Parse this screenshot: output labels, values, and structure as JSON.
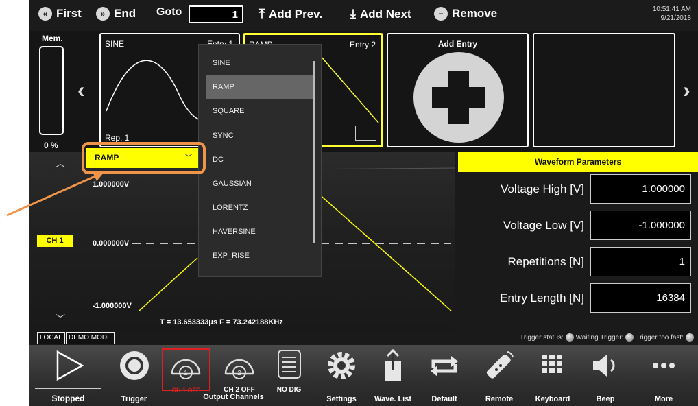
{
  "toolbar": {
    "first": "First",
    "end": "End",
    "goto": "Goto",
    "goto_value": "1",
    "add_prev": "Add Prev.",
    "add_next": "Add Next",
    "remove": "Remove",
    "time": "10:51:41 AM",
    "date": "9/21/2018"
  },
  "memory": {
    "label": "Mem.",
    "percent": "0 %"
  },
  "entries": [
    {
      "name": "SINE",
      "entry": "Entry 1",
      "rep": "Rep. 1"
    },
    {
      "name": "RAMP",
      "entry": "Entry 2"
    }
  ],
  "add_entry": "Add Entry",
  "waveform_select": {
    "selected": "RAMP",
    "options": [
      "SINE",
      "RAMP",
      "SQUARE",
      "SYNC",
      "DC",
      "GAUSSIAN",
      "LORENTZ",
      "HAVERSINE",
      "EXP_RISE"
    ]
  },
  "plot": {
    "vhigh": "1.000000V",
    "vzero": "0.000000V",
    "vlow": "-1.000000V",
    "channel": "CH 1",
    "tf": "T =  13.653333μs  F =  73.242188KHz"
  },
  "params": {
    "title": "Waveform Parameters",
    "rows": [
      {
        "label": "Voltage High [V]",
        "value": "1.000000"
      },
      {
        "label": "Voltage Low [V]",
        "value": "-1.000000"
      },
      {
        "label": "Repetitions [N]",
        "value": "1"
      },
      {
        "label": "Entry Length [N]",
        "value": "16384"
      }
    ]
  },
  "modes": {
    "local": "LOCAL",
    "demo": "DEMO MODE"
  },
  "trigger_status": {
    "status": "Trigger status:",
    "waiting": "Waiting Trigger:",
    "too_fast": "Trigger too fast:"
  },
  "bottom": {
    "stopped": "Stopped",
    "trigger": "Trigger",
    "ch1": "CH 1 OFF",
    "ch2": "CH 2 OFF",
    "nodig": "NO DIG",
    "output_channels": "Output Channels",
    "settings": "Settings",
    "wave_list": "Wave. List",
    "default": "Default",
    "remote": "Remote",
    "keyboard": "Keyboard",
    "beep": "Beep",
    "more": "More"
  },
  "colors": {
    "accent": "#ffff00",
    "callout": "#f0944a",
    "ch1_off": "#e02020"
  }
}
